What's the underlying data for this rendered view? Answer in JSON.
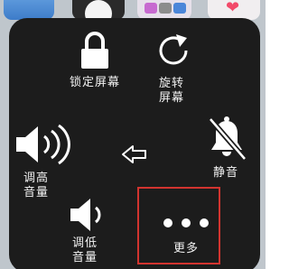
{
  "assistive_touch": {
    "lock_screen": "锁定屏幕",
    "rotate_screen": [
      "旋转",
      "屏幕"
    ],
    "volume_up": [
      "调高",
      "音量"
    ],
    "mute": "静音",
    "volume_down": [
      "调低",
      "音量"
    ],
    "more": "更多"
  },
  "colors": {
    "panel_bg": "#1c1c1c",
    "icon": "#ffffff",
    "highlight": "#d2342f"
  },
  "icons": [
    "lock-icon",
    "rotate-icon",
    "speaker-loud-icon",
    "back-arrow-icon",
    "bell-mute-icon",
    "speaker-quiet-icon",
    "more-dots-icon"
  ]
}
